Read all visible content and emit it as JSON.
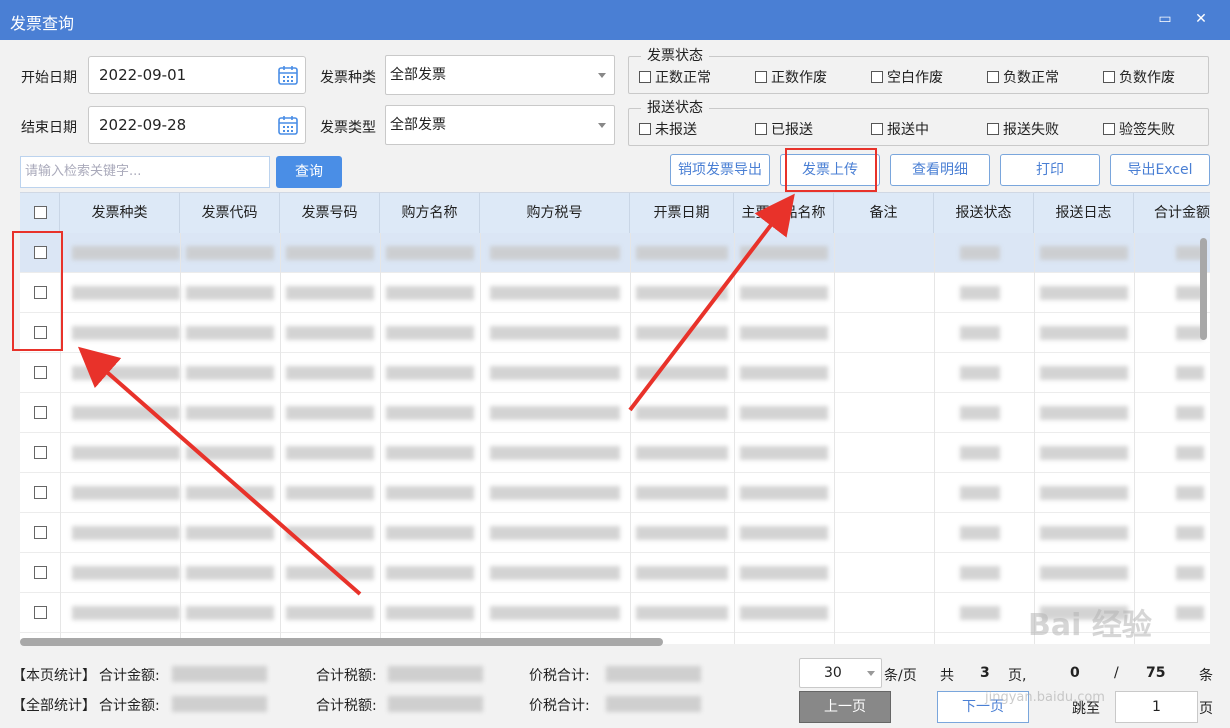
{
  "window": {
    "title": "发票查询",
    "maximize_glyph": "▭",
    "close_glyph": "✕"
  },
  "filters": {
    "start_date_label": "开始日期",
    "start_date": "2022-09-01",
    "end_date_label": "结束日期",
    "end_date": "2022-09-28",
    "invoice_kind_label": "发票种类",
    "invoice_kind_value": "全部发票",
    "invoice_type_label": "发票类型",
    "invoice_type_value": "全部发票"
  },
  "invoice_status": {
    "legend": "发票状态",
    "options": [
      "正数正常",
      "正数作废",
      "空白作废",
      "负数正常",
      "负数作废"
    ]
  },
  "report_status": {
    "legend": "报送状态",
    "options": [
      "未报送",
      "已报送",
      "报送中",
      "报送失败",
      "验签失败"
    ]
  },
  "search": {
    "placeholder": "请输入检索关键字...",
    "query_label": "查询"
  },
  "toolbar": {
    "export_sales_label": "销项发票导出",
    "upload_label": "发票上传",
    "view_detail_label": "查看明细",
    "print_label": "打印",
    "export_excel_label": "导出Excel"
  },
  "table": {
    "columns": [
      "发票种类",
      "发票代码",
      "发票号码",
      "购方名称",
      "购方税号",
      "开票日期",
      "主要商品名称",
      "备注",
      "报送状态",
      "报送日志",
      "合计金额"
    ]
  },
  "footer": {
    "page_stat_label": "【本页统计】",
    "all_stat_label": "【全部统计】",
    "amount_label": "合计金额:",
    "tax_label": "合计税额:",
    "total_label": "价税合计:",
    "page_size": "30",
    "per_page_label": "条/页",
    "total_prefix": "共",
    "total_pages": "3",
    "pages_label": "页,",
    "current_count": "0",
    "slash": "/",
    "total_count": "75",
    "count_unit": "条",
    "prev_label": "上一页",
    "next_label": "下一页",
    "jump_label": "跳至",
    "jump_value": "1",
    "jump_unit": "页"
  },
  "watermark": {
    "brand": "Bai 经验",
    "url": "jingyan.baidu.com"
  },
  "colors": {
    "titlebar": "#4a7fd4",
    "accent": "#4a8ee6",
    "highlight": "#e8322a"
  }
}
